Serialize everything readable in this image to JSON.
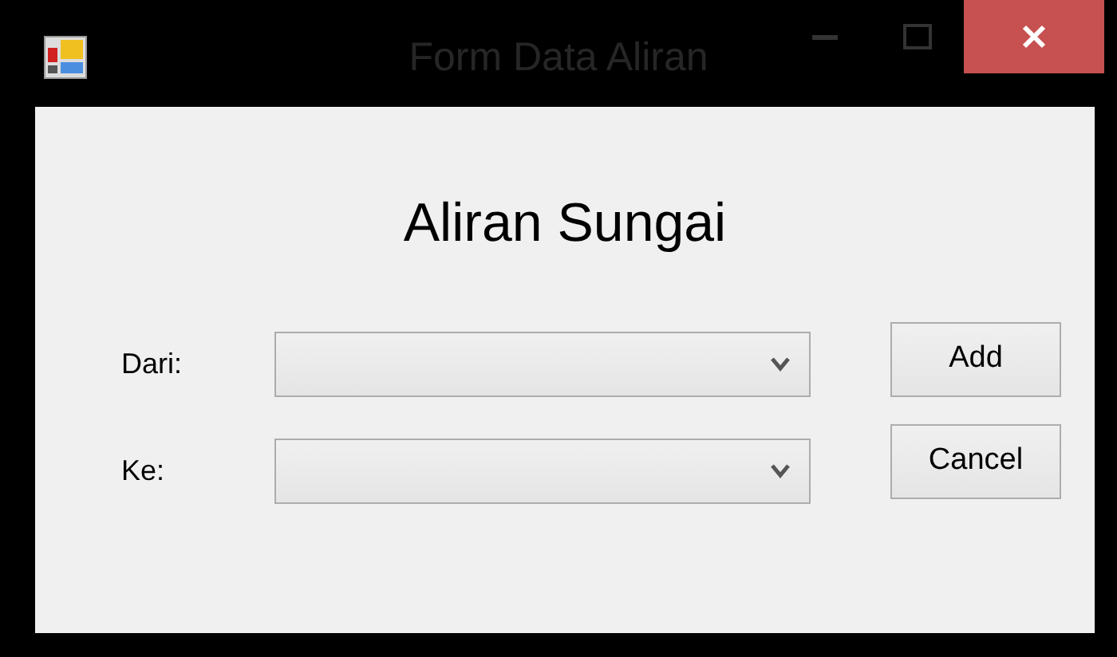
{
  "window": {
    "title": "Form Data Aliran"
  },
  "heading": "Aliran Sungai",
  "fields": [
    {
      "label": "Dari:"
    },
    {
      "label": "Ke:"
    }
  ],
  "buttons": [
    {
      "label": "Add"
    },
    {
      "label": "Cancel"
    }
  ]
}
